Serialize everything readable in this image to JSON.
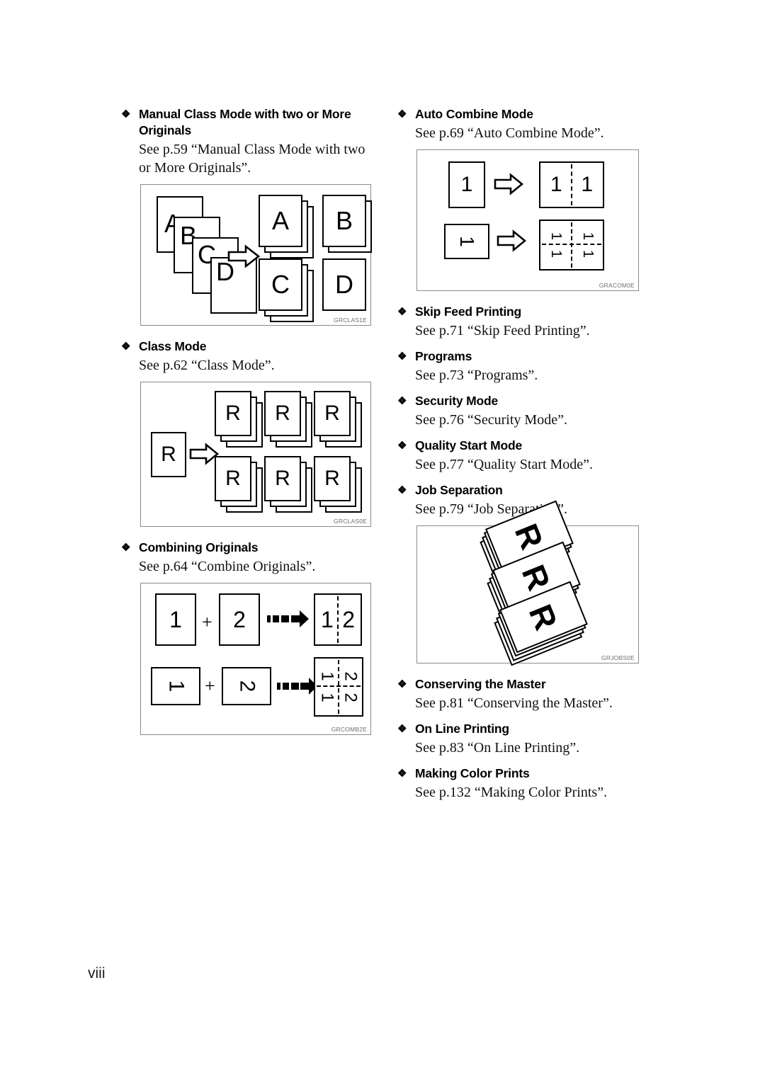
{
  "page": {
    "number": "viii"
  },
  "left_column": {
    "entries": [
      {
        "heading": "Manual Class Mode with two or More Originals",
        "body": "See p.59 “Manual Class Mode with two or More Originals”.",
        "figure_caption": "GRCLAS1E",
        "figure_input_labels": [
          "A",
          "B",
          "C",
          "D"
        ],
        "figure_output_labels": [
          "A",
          "B",
          "C",
          "D"
        ]
      },
      {
        "heading": "Class Mode",
        "body": "See p.62 “Class Mode”.",
        "figure_caption": "GRCLAS0E",
        "figure_input_labels": [
          "R"
        ],
        "figure_output_labels": [
          "R",
          "R",
          "R",
          "R",
          "R",
          "R"
        ]
      },
      {
        "heading": "Combining Originals",
        "body": "See p.64 “Combine Originals”.",
        "figure_caption": "GRCOMB2E",
        "figure_row1": {
          "input_a": "1",
          "plus": "+",
          "input_b": "2",
          "output_left": "1",
          "output_right": "2"
        },
        "figure_row2": {
          "input_a": "1",
          "plus": "+",
          "input_b": "2",
          "output_quadrants": [
            "1",
            "2",
            "1",
            "2"
          ]
        }
      }
    ]
  },
  "right_column": {
    "entries": [
      {
        "heading": "Auto Combine Mode",
        "body": "See p.69 “Auto Combine Mode”.",
        "figure_caption": "GRACOM0E",
        "figure_row1": {
          "input": "1",
          "output_left": "1",
          "output_right": "1"
        },
        "figure_row2": {
          "input": "1",
          "output_quadrants": [
            "1",
            "1",
            "1",
            "1"
          ]
        }
      },
      {
        "heading": "Skip Feed Printing",
        "body": "See p.71 “Skip Feed Printing”."
      },
      {
        "heading": "Programs",
        "body": "See p.73 “Programs”."
      },
      {
        "heading": "Security Mode",
        "body": "See p.76 “Security Mode”."
      },
      {
        "heading": "Quality Start Mode",
        "body": "See p.77 “Quality Start Mode”."
      },
      {
        "heading": "Job Separation",
        "body": "See p.79 “Job Separation”.",
        "figure_caption": "GRJOBS0E",
        "figure_labels": [
          "R",
          "R",
          "R"
        ]
      },
      {
        "heading": "Conserving the Master",
        "body": "See p.81 “Conserving the Master”."
      },
      {
        "heading": "On Line Printing",
        "body": "See p.83 “On Line Printing”."
      },
      {
        "heading": "Making Color Prints",
        "body": "See p.132 “Making Color Prints”."
      }
    ]
  },
  "icons": {
    "bullet": "❖",
    "arrow_outline": "arrow-right-outline-icon",
    "arrow_solid": "arrow-right-dashed-solid-icon"
  }
}
